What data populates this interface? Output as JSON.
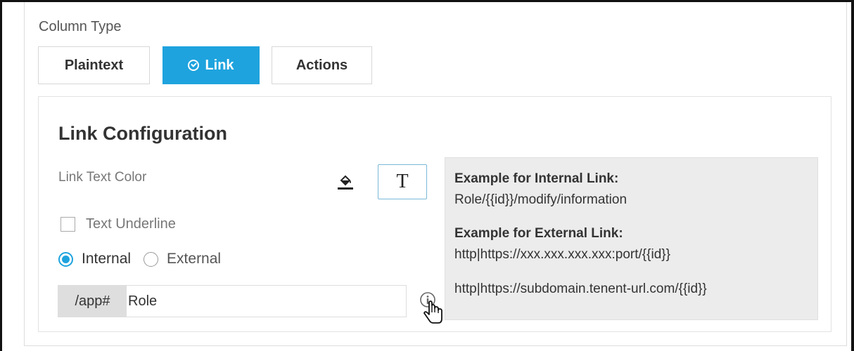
{
  "column_type": {
    "label": "Column Type",
    "options": [
      {
        "label": "Plaintext",
        "selected": false
      },
      {
        "label": "Link",
        "selected": true
      },
      {
        "label": "Actions",
        "selected": false
      }
    ]
  },
  "link_config": {
    "title": "Link Configuration",
    "text_color_label": "Link Text Color",
    "text_style_button": "T",
    "underline_label": "Text Underline",
    "underline_checked": false,
    "link_type": {
      "internal_label": "Internal",
      "external_label": "External",
      "selected": "Internal"
    },
    "url": {
      "prefix": "/app#",
      "value": "Role"
    }
  },
  "examples": {
    "internal_heading": "Example for Internal Link:",
    "internal_example": "Role/{{id}}/modify/information",
    "external_heading": "Example for External Link:",
    "external_examples": [
      "http|https://xxx.xxx.xxx.xxx:port/{{id}}",
      "http|https://subdomain.tenent-url.com/{{id}}"
    ]
  },
  "colors": {
    "accent": "#1ea3de",
    "example_bg": "#ececec",
    "prefix_bg": "#dedede"
  },
  "icons": [
    "check-circle-icon",
    "fill-color-icon",
    "info-icon",
    "hand-pointer-icon"
  ]
}
